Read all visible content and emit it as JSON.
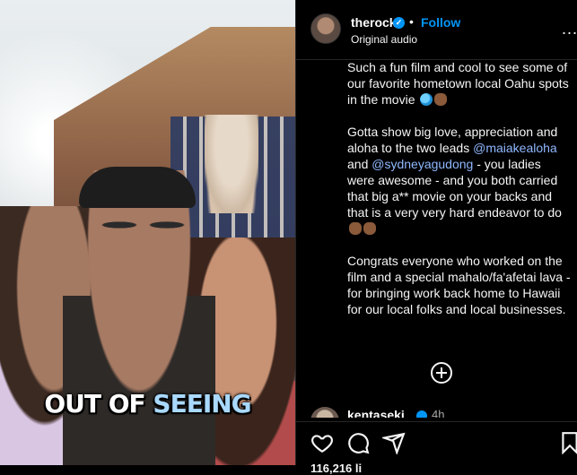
{
  "media": {
    "caption_word1": "OUT OF",
    "caption_word2": "SEEING"
  },
  "post_header": {
    "username": "therock",
    "follow_label": "Follow",
    "audio_label": "Original audio",
    "more_label": "..."
  },
  "caption": {
    "p1": "Such a fun film and cool to see some of our favorite hometown local Oahu spots in the movie",
    "p2_pre": "Gotta show big love, appreciation and aloha to the two leads",
    "mention1": "@maiakealoha",
    "p2_and": "and",
    "mention2": "@sydneyagudong",
    "p2_post": "- you ladies were awesome - and you both carried that big a** movie on your backs and that is a very very hard endeavor to do",
    "p3": "Congrats everyone who worked on the film and a special mahalo/fa'afetai lava - for bringing work back home to Hawaii for our local folks and local businesses."
  },
  "comment": {
    "username": "kentaseki",
    "time": "4h"
  },
  "actions": {
    "like_icon": "heart-icon",
    "comment_icon": "comment-icon",
    "share_icon": "share-icon",
    "save_icon": "bookmark-icon",
    "likes_partial": "116,216 li"
  },
  "colors": {
    "accent": "#0095f6",
    "mention": "#8fb8ff",
    "background": "#000000"
  }
}
